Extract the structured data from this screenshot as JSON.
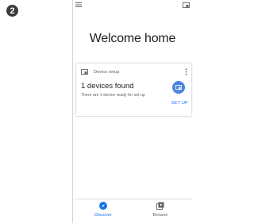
{
  "step_number": "2",
  "colors": {
    "accent": "#1a73e8",
    "fab": "#4a86e0",
    "muted": "#5f6368",
    "text": "#202124"
  },
  "header": {
    "welcome_title": "Welcome home"
  },
  "icons": {
    "menu": "menu-icon",
    "top_right": "cast-device-icon",
    "card_header": "cast-device-icon",
    "more": "more-vert-icon",
    "fab": "cast-device-icon",
    "discover": "compass-icon",
    "browse": "browse-stack-icon"
  },
  "card": {
    "header_label": "Device setup",
    "title": "1 devices found",
    "subtitle": "There are 1 device ready for set up",
    "action_label": "SET UP"
  },
  "bottom_nav": {
    "items": [
      {
        "label": "Discover",
        "active": true
      },
      {
        "label": "Browse",
        "active": false
      }
    ]
  }
}
